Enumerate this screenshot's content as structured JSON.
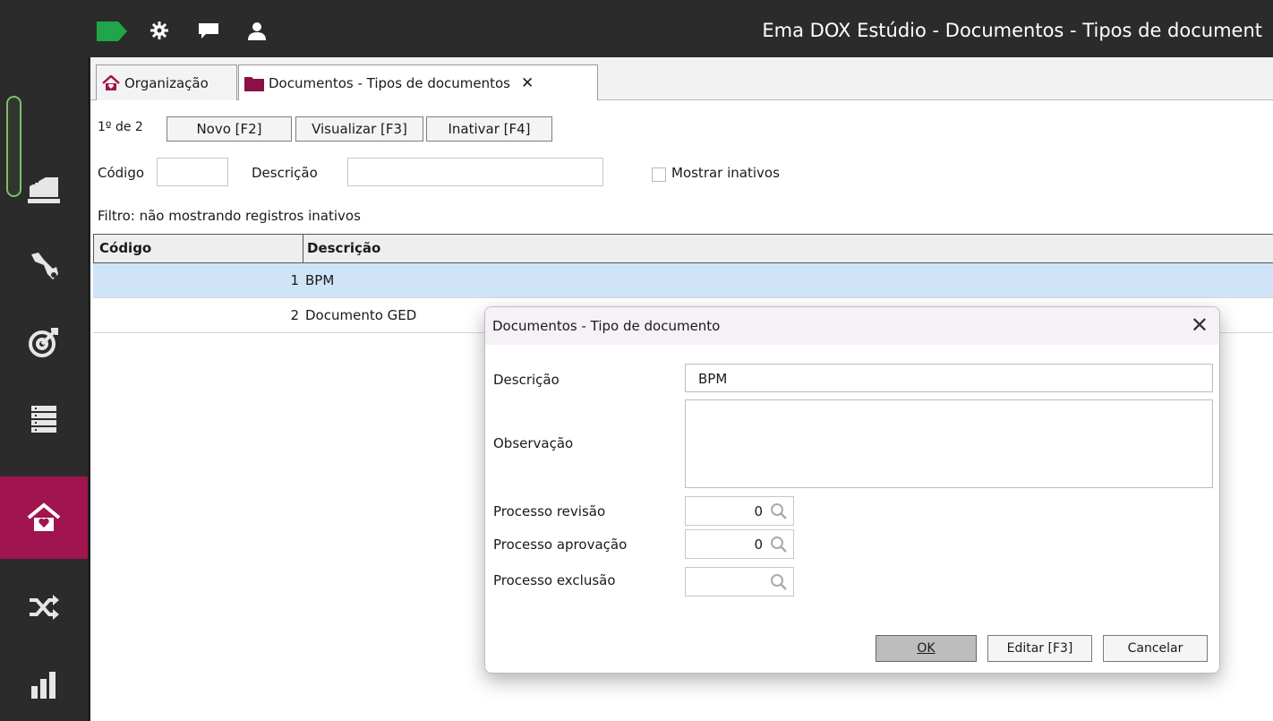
{
  "window": {
    "title": "Ema DOX Estúdio - Documentos - Tipos de document"
  },
  "topbar": {
    "icons": [
      "flag-icon",
      "gear-icon",
      "chat-icon",
      "user-icon"
    ]
  },
  "sidebar": {
    "items": [
      {
        "icon": "dashboard-icon",
        "active": false
      },
      {
        "icon": "tools-icon",
        "active": false
      },
      {
        "icon": "target-icon",
        "active": false
      },
      {
        "icon": "list-icon",
        "active": false
      },
      {
        "icon": "home-heart-icon",
        "active": true
      },
      {
        "icon": "shuffle-icon",
        "active": false
      },
      {
        "icon": "bar-chart-icon",
        "active": false
      }
    ],
    "accent_color": "#a0144f"
  },
  "tabs": [
    {
      "label": "Organização",
      "icon": "home-icon"
    },
    {
      "label": "Documentos - Tipos de documentos",
      "icon": "folder-icon",
      "close": "✕"
    }
  ],
  "toolbar": {
    "record_count": "1º de 2",
    "new_label": "Novo [F2]",
    "view_label": "Visualizar [F3]",
    "inactivate_label": "Inativar [F4]"
  },
  "filters": {
    "code_label": "Código",
    "code_value": "",
    "description_label": "Descrição",
    "description_value": "",
    "show_inactive_label": "Mostrar inativos",
    "show_inactive_checked": false,
    "filter_text": "Filtro:  não mostrando registros inativos"
  },
  "grid": {
    "columns": [
      "Código",
      "Descrição"
    ],
    "rows": [
      {
        "code": "1",
        "description": "BPM",
        "selected": true
      },
      {
        "code": "2",
        "description": "Documento GED",
        "selected": false
      }
    ]
  },
  "dialog": {
    "title": "Documentos - Tipo de documento",
    "close": "✕",
    "description_label": "Descrição",
    "description_value": "BPM",
    "observation_label": "Observação",
    "observation_value": "",
    "review_label": "Processo revisão",
    "review_value": "0",
    "approval_label": "Processo aprovação",
    "approval_value": "0",
    "exclusion_label": "Processo exclusão",
    "exclusion_value": "",
    "ok_label": "OK",
    "edit_label": "Editar [F3]",
    "cancel_label": "Cancelar"
  }
}
